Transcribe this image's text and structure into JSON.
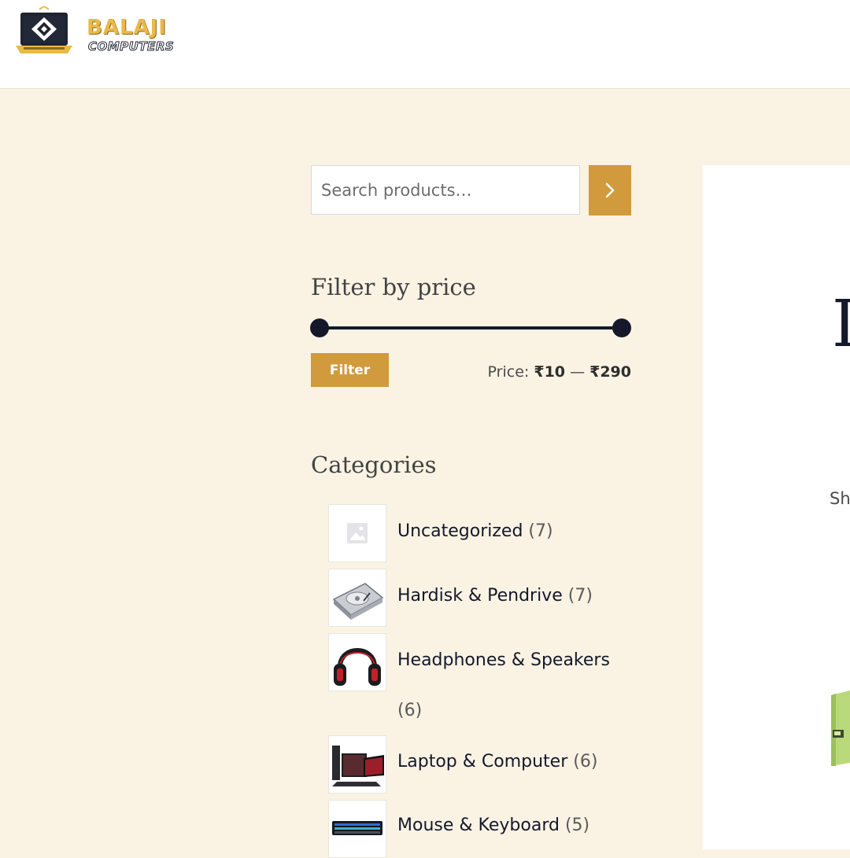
{
  "header": {
    "logo_line1": "BALAJI",
    "logo_line2": "COMPUTERS"
  },
  "search": {
    "placeholder": "Search products…",
    "button_icon": "chevron-right-icon"
  },
  "price_filter": {
    "title": "Filter by price",
    "filter_label": "Filter",
    "price_prefix": "Price:",
    "min_price": "₹10",
    "separator": "—",
    "max_price": "₹290"
  },
  "categories": {
    "title": "Categories",
    "items": [
      {
        "label": "Uncategorized",
        "count": "(7)",
        "icon": "placeholder-image-icon"
      },
      {
        "label": "Hardisk & Pendrive",
        "count": "(7)",
        "icon": "hard-disk-icon"
      },
      {
        "label": "Headphones & Speakers",
        "count": "(6)",
        "icon": "headphones-icon"
      },
      {
        "label": "Laptop & Computer",
        "count": "(6)",
        "icon": "laptop-icon"
      },
      {
        "label": "Mouse & Keyboard",
        "count": "(5)",
        "icon": "keyboard-icon"
      }
    ]
  },
  "main": {
    "heading_partial": "I",
    "result_count_partial": "Sh"
  },
  "colors": {
    "page_bg": "#faf3e4",
    "accent": "#d19a3d",
    "dark": "#14182a",
    "logo_gold": "#e9b949"
  }
}
